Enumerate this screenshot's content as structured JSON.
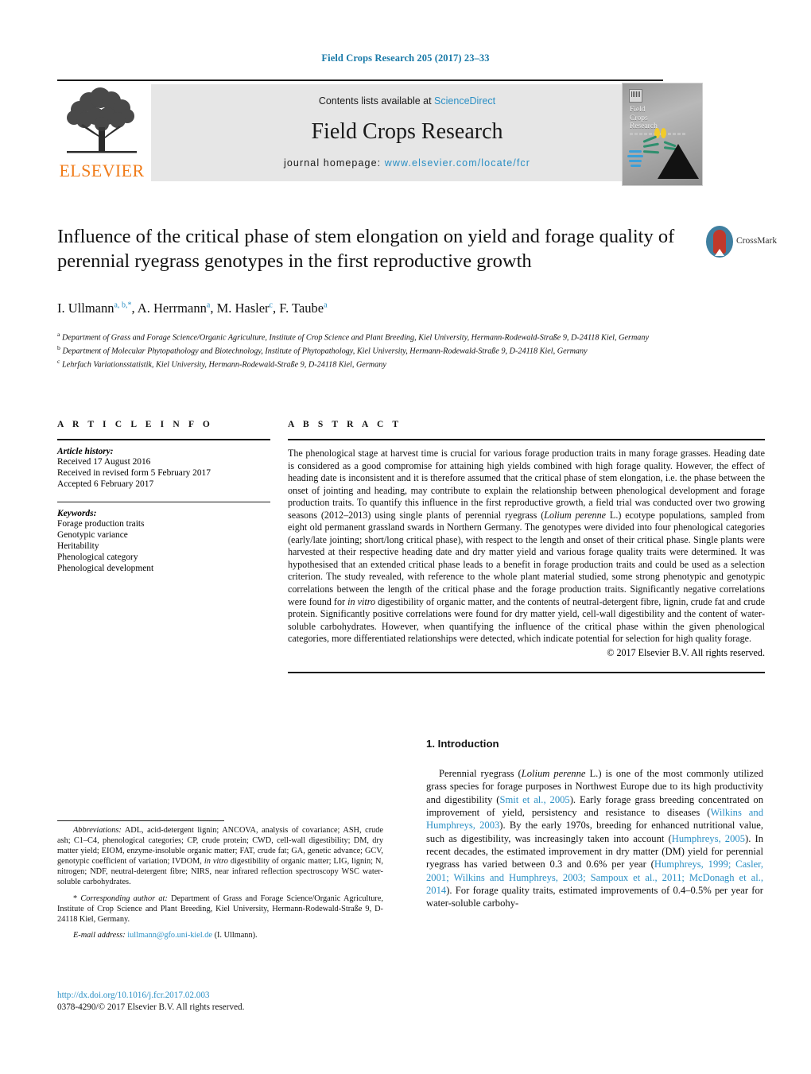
{
  "running_head": "Field Crops Research 205 (2017) 23–33",
  "header": {
    "contents_prefix": "Contents lists available at ",
    "contents_link": "ScienceDirect",
    "journal_title": "Field Crops Research",
    "homepage_prefix": "journal homepage: ",
    "homepage_link": "www.elsevier.com/locate/fcr",
    "publisher_logo_text": "ELSEVIER",
    "cover_title_lines": [
      "Field",
      "Crops",
      "Research"
    ]
  },
  "article": {
    "title": "Influence of the critical phase of stem elongation on yield and forage quality of perennial ryegrass genotypes in the first reproductive growth",
    "crossmark_label": "CrossMark",
    "authors_html": "I. Ullmann<sup>a, b,*</sup>, A. Herrmann<sup>a</sup>, M. Hasler<sup>c</sup>, F. Taube<sup>a</sup>",
    "affiliations": [
      {
        "marker": "a",
        "text": "Department of Grass and Forage Science/Organic Agriculture, Institute of Crop Science and Plant Breeding, Kiel University, Hermann-Rodewald-Straße 9, D-24118 Kiel, Germany"
      },
      {
        "marker": "b",
        "text": "Department of Molecular Phytopathology and Biotechnology, Institute of Phytopathology, Kiel University, Hermann-Rodewald-Straße 9, D-24118 Kiel, Germany"
      },
      {
        "marker": "c",
        "text": "Lehrfach Variationsstatistik, Kiel University, Hermann-Rodewald-Straße 9, D-24118 Kiel, Germany"
      }
    ]
  },
  "article_info": {
    "section_label": "A R T I C L E   I N F O",
    "history_title": "Article history:",
    "history": [
      "Received 17 August 2016",
      "Received in revised form 5 February 2017",
      "Accepted 6 February 2017"
    ],
    "keywords_title": "Keywords:",
    "keywords": [
      "Forage production traits",
      "Genotypic variance",
      "Heritability",
      "Phenological category",
      "Phenological development"
    ]
  },
  "abstract": {
    "section_label": "A B S T R A C T",
    "text_html": "The phenological stage at harvest time is crucial for various forage production traits in many forage grasses. Heading date is considered as a good compromise for attaining high yields combined with high forage quality. However, the effect of heading date is inconsistent and it is therefore assumed that the critical phase of stem elongation, i.e. the phase between the onset of jointing and heading, may contribute to explain the relationship between phenological development and forage production traits. To quantify this influence in the first reproductive growth, a field trial was conducted over two growing seasons (2012&ndash;2013) using single plants of perennial ryegrass (<em>Lolium perenne</em> L.) ecotype populations, sampled from eight old permanent grassland swards in Northern Germany. The genotypes were divided into four phenological categories (early/late jointing; short/long critical phase), with respect to the length and onset of their critical phase. Single plants were harvested at their respective heading date and dry matter yield and various forage quality traits were determined. It was hypothesised that an extended critical phase leads to a benefit in forage production traits and could be used as a selection criterion. The study revealed, with reference to the whole plant material studied, some strong phenotypic and genotypic correlations between the length of the critical phase and the forage production traits. Significantly negative correlations were found for <em>in vitro</em> digestibility of organic matter, and the contents of neutral-detergent fibre, lignin, crude fat and crude protein. Significantly positive correlations were found for dry matter yield, cell-wall digestibility and the content of water-soluble carbohydrates. However, when quantifying the influence of the critical phase within the given phenological categories, more differentiated relationships were detected, which indicate potential for selection for high quality forage.",
    "copyright": "© 2017 Elsevier B.V. All rights reserved."
  },
  "footnotes": {
    "abbreviations_html": "<em>Abbreviations:</em> ADL, acid-detergent lignin; ANCOVA, analysis of covariance; ASH, crude ash; C1–C4, phenological categories; CP, crude protein; CWD, cell-wall digestibility; DM, dry matter yield; EIOM, enzyme-insoluble organic matter; FAT, crude fat; GA, genetic advance; GCV, genotypic coefficient of variation; IVDOM, <em>in vitro</em> digestibility of organic matter; LIG, lignin; N, nitrogen; NDF, neutral-detergent fibre; NIRS, near infrared reflection spectroscopy WSC water-soluble carbohydrates.",
    "corresponding_html": "* <em>Corresponding author at:</em> Department of Grass and Forage Science/Organic Agriculture, Institute of Crop Science and Plant Breeding, Kiel University, Hermann-Rodewald-Straße 9, D-24118 Kiel, Germany.",
    "email_label": "E-mail address:",
    "email": "iullmann@gfo.uni-kiel.de",
    "email_owner": "(I. Ullmann)."
  },
  "doi_block": {
    "doi_url": "http://dx.doi.org/10.1016/j.fcr.2017.02.003",
    "issn_line": "0378-4290/© 2017 Elsevier B.V. All rights reserved."
  },
  "introduction": {
    "heading": "1. Introduction",
    "paragraph_html": "Perennial ryegrass (<em>Lolium perenne</em> L.) is one of the most commonly utilized grass species for forage purposes in Northwest Europe due to its high productivity and digestibility (<span class=\"cite\">Smit et al., 2005</span>). Early forage grass breeding concentrated on improvement of yield, persistency and resistance to diseases (<span class=\"cite\">Wilkins and Humphreys, 2003</span>). By the early 1970s, breeding for enhanced nutritional value, such as digestibility, was increasingly taken into account (<span class=\"cite\">Humphreys, 2005</span>). In recent decades, the estimated improvement in dry matter (DM) yield for perennial ryegrass has varied between 0.3 and 0.6% per year (<span class=\"cite\">Humphreys, 1999; Casler, 2001; Wilkins and Humphreys, 2003; Sampoux et al., 2011; McDonagh et al., 2014</span>). For forage quality traits, estimated improvements of 0.4–0.5% per year for water-soluble carbohy-"
  },
  "colors": {
    "link_blue": "#2b8fc4",
    "running_head_blue": "#1a7aa8",
    "elsevier_orange": "#F07C1A",
    "header_grey": "#e6e6e6"
  }
}
